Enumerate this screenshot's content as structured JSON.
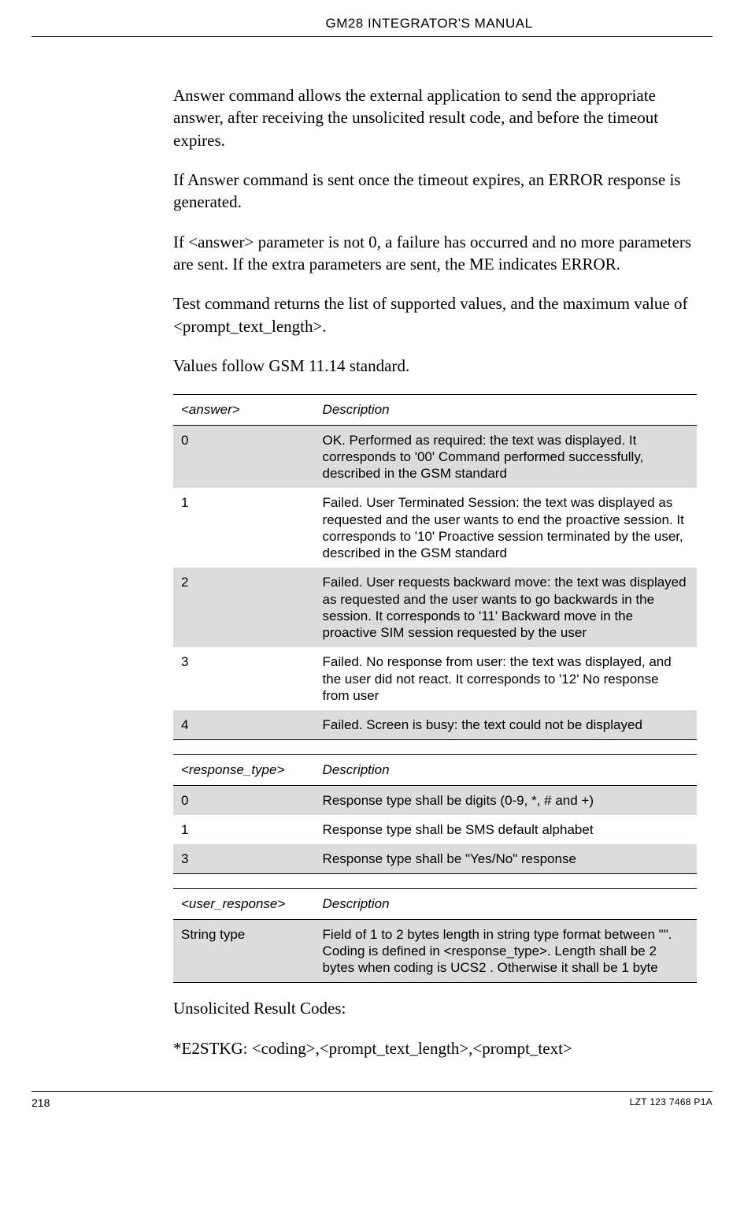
{
  "header": {
    "title": "GM28 INTEGRATOR'S MANUAL"
  },
  "paragraphs": {
    "p1": "Answer command allows the external application to send the appropriate answer, after receiving the unsolicited result code, and before the timeout expires.",
    "p2": "If Answer command is sent once the timeout expires, an ERROR response is generated.",
    "p3": "If <answer> parameter is not 0, a failure has occurred and no more parameters are sent. If the extra parameters are sent, the ME indicates ERROR.",
    "p4": "Test command returns the list of supported values, and the maximum value of <prompt_text_length>.",
    "p5": "Values follow GSM 11.14 standard.",
    "p6": "Unsolicited Result Codes:",
    "p7": "*E2STKG: <coding>,<prompt_text_length>,<prompt_text>"
  },
  "table_answer": {
    "head": {
      "key": "<answer>",
      "desc": "Description"
    },
    "rows": [
      {
        "key": "0",
        "desc": "OK.\nPerformed as required: the text was displayed. It corresponds to '00' Command performed successfully, described in the GSM standard"
      },
      {
        "key": "1",
        "desc": "Failed.\nUser Terminated Session: the text was displayed as requested and the user wants to end the proactive session. It corresponds to '10' Proactive session terminated by the user, described in the GSM standard"
      },
      {
        "key": "2",
        "desc": "Failed.\nUser requests backward move: the text was displayed as requested and the user wants to go backwards in the session. It corresponds to '11' Backward move in the proactive SIM session requested by the user"
      },
      {
        "key": "3",
        "desc": "Failed.\nNo response from user: the text was displayed, and the user did not react. It corresponds to '12' No response from user"
      },
      {
        "key": "4",
        "desc": "Failed.\nScreen is busy: the text could not be displayed"
      }
    ]
  },
  "table_response": {
    "head": {
      "key": "<response_type>",
      "desc": "Description"
    },
    "rows": [
      {
        "key": "0",
        "desc": "Response type shall be digits (0-9, *, # and +)"
      },
      {
        "key": "1",
        "desc": "Response type shall be SMS default alphabet"
      },
      {
        "key": "3",
        "desc": "Response type shall be \"Yes/No\" response"
      }
    ]
  },
  "table_user_response": {
    "head": {
      "key": "<user_response>",
      "desc": "Description"
    },
    "rows": [
      {
        "key": "String type",
        "desc": "Field of 1 to 2 bytes length in string type format between \"\". Coding is defined in <response_type>. Length shall be 2 bytes when coding is UCS2 . Otherwise it shall be 1 byte"
      }
    ]
  },
  "footer": {
    "page_number": "218",
    "doc_number": "LZT 123 7468 P1A"
  }
}
